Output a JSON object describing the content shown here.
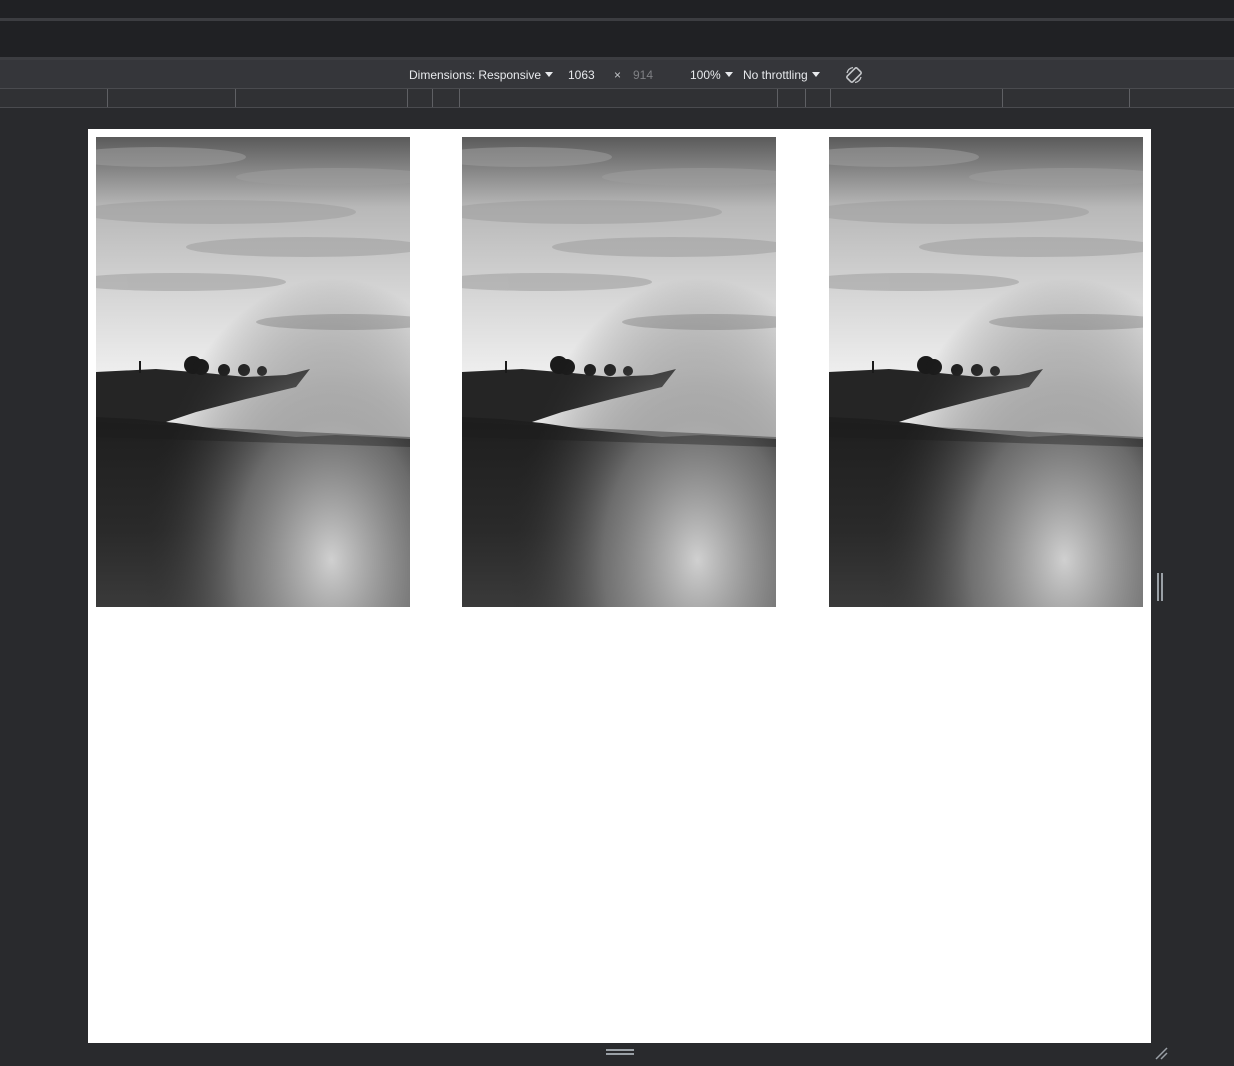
{
  "device_toolbar": {
    "dimensions_label": "Dimensions: Responsive",
    "width_value": "1063",
    "separator": "×",
    "height_value": "914",
    "zoom": "100%",
    "throttling": "No throttling",
    "rotate_icon": "rotate-icon"
  },
  "page": {
    "images": [
      {
        "alt": "Black and white landscape of sea of clouds over a forested hill"
      },
      {
        "alt": "Black and white landscape of sea of clouds over a forested hill"
      },
      {
        "alt": "Black and white landscape of sea of clouds over a forested hill"
      }
    ]
  },
  "colors": {
    "devtools_bg": "#292a2d",
    "toolbar_bg": "#35363a",
    "viewport_bg": "#ffffff"
  }
}
